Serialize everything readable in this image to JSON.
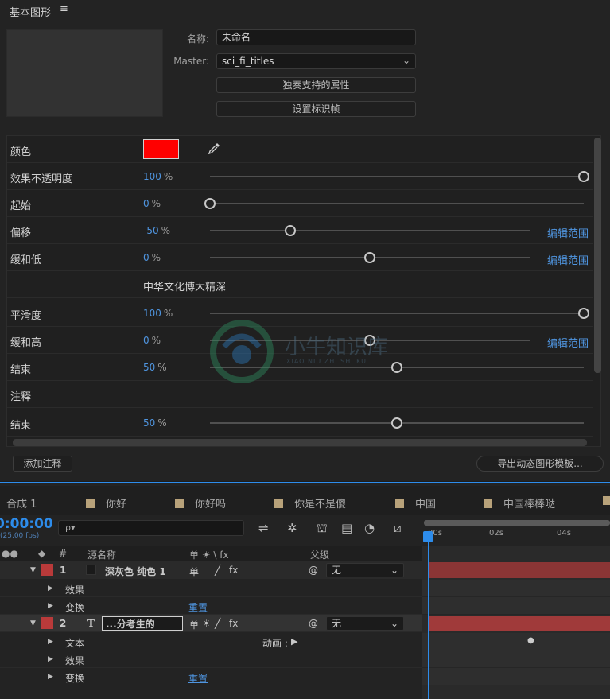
{
  "panel": {
    "title": "基本图形",
    "menu_icon": "≡"
  },
  "meta": {
    "name_label": "名称:",
    "name_value": "未命名",
    "master_label": "Master:",
    "master_value": "sci_fi_titles",
    "solo_button": "独奏支持的属性",
    "poster_button": "设置标识帧"
  },
  "props": {
    "color_label": "颜色",
    "opacity": {
      "label": "效果不透明度",
      "value": "100",
      "unit": "%",
      "level": 1.0
    },
    "start": {
      "label": "起始",
      "value": "0",
      "unit": "%",
      "level": 0.0
    },
    "offset": {
      "label": "偏移",
      "value": "-50",
      "unit": "%",
      "level": 0.25,
      "link": "编辑范围"
    },
    "ease_low": {
      "label": "缓和低",
      "value": "0",
      "unit": "%",
      "level": 0.5,
      "link": "编辑范围"
    },
    "text_row": "中华文化博大精深",
    "smooth": {
      "label": "平滑度",
      "value": "100",
      "unit": "%",
      "level": 1.0
    },
    "ease_high": {
      "label": "缓和高",
      "value": "0",
      "unit": "%",
      "level": 0.5,
      "link": "编辑范围"
    },
    "end1": {
      "label": "结束",
      "value": "50",
      "unit": "%",
      "level": 0.5
    },
    "comment": {
      "label": "注释"
    },
    "end2": {
      "label": "结束",
      "value": "50",
      "unit": "%",
      "level": 0.5
    },
    "swatch_color": "#ff0000"
  },
  "footer": {
    "add_comment": "添加注释",
    "export": "导出动态图形模板..."
  },
  "timeline": {
    "tabs": [
      "合成 1",
      "你好",
      "你好吗",
      "你是不是傻",
      "中国",
      "中国棒棒哒"
    ],
    "timecode": "0:00:00",
    "fps": "(25.00 fps)",
    "search_placeholder": "ρ▾",
    "ruler": [
      "00s",
      "02s",
      "04s"
    ],
    "col_num": "#",
    "col_source": "源名称",
    "col_switches": "单 ☀ \\ fx",
    "col_parent": "父级",
    "layers": [
      {
        "num": "1",
        "name": "深灰色 纯色 1",
        "parent": "无",
        "children": [
          {
            "label": "效果"
          },
          {
            "label": "变换",
            "link": "重置"
          }
        ]
      },
      {
        "num": "2",
        "type": "T",
        "name": "...分考生的",
        "parent": "无",
        "children": [
          {
            "label": "文本",
            "extra": "动画 :"
          },
          {
            "label": "效果"
          },
          {
            "label": "变换",
            "link": "重置"
          }
        ]
      }
    ]
  },
  "watermark": {
    "text": "小牛知识库",
    "sub": "XIAO NIU ZHI SHI KU"
  }
}
